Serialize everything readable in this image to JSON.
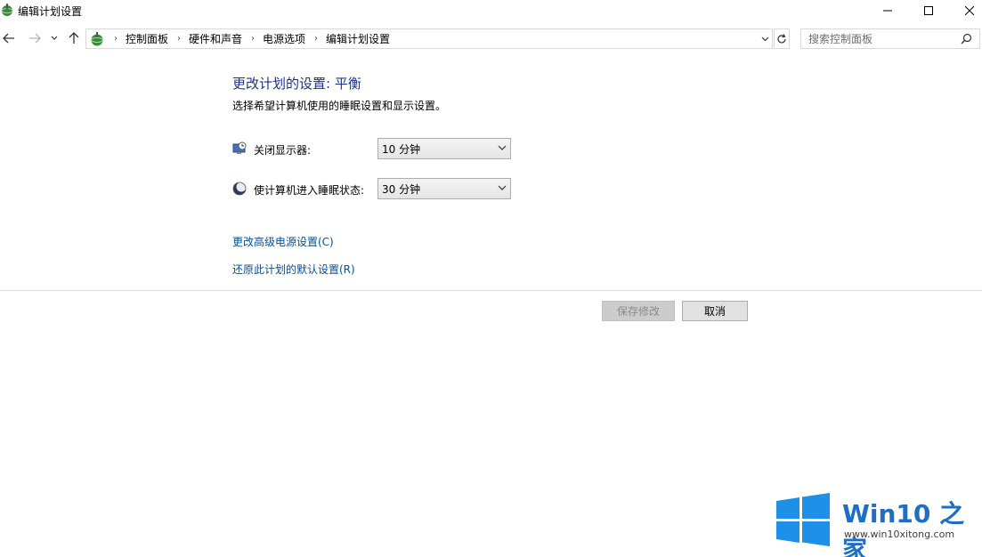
{
  "window": {
    "title": "编辑计划设置",
    "minimize_label": "",
    "maximize_label": "",
    "close_label": ""
  },
  "nav": {
    "breadcrumb": [
      "控制面板",
      "硬件和声音",
      "电源选项",
      "编辑计划设置"
    ],
    "search_placeholder": "搜索控制面板"
  },
  "main": {
    "heading": "更改计划的设置: 平衡",
    "subtext": "选择希望计算机使用的睡眠设置和显示设置。",
    "settings": [
      {
        "label": "关闭显示器:",
        "value": "10 分钟",
        "icon": "monitor-clock-icon"
      },
      {
        "label": "使计算机进入睡眠状态:",
        "value": "30 分钟",
        "icon": "moon-icon"
      }
    ],
    "links": [
      "更改高级电源设置(C)",
      "还原此计划的默认设置(R)"
    ],
    "buttons": {
      "save": "保存修改",
      "cancel": "取消"
    }
  },
  "watermark": {
    "brand": "Win10 之家",
    "url": "www.win10xitong.com"
  },
  "colors": {
    "heading": "#1e3287",
    "link": "#0a4f8f",
    "watermark_blue": "#1e6fc2"
  }
}
